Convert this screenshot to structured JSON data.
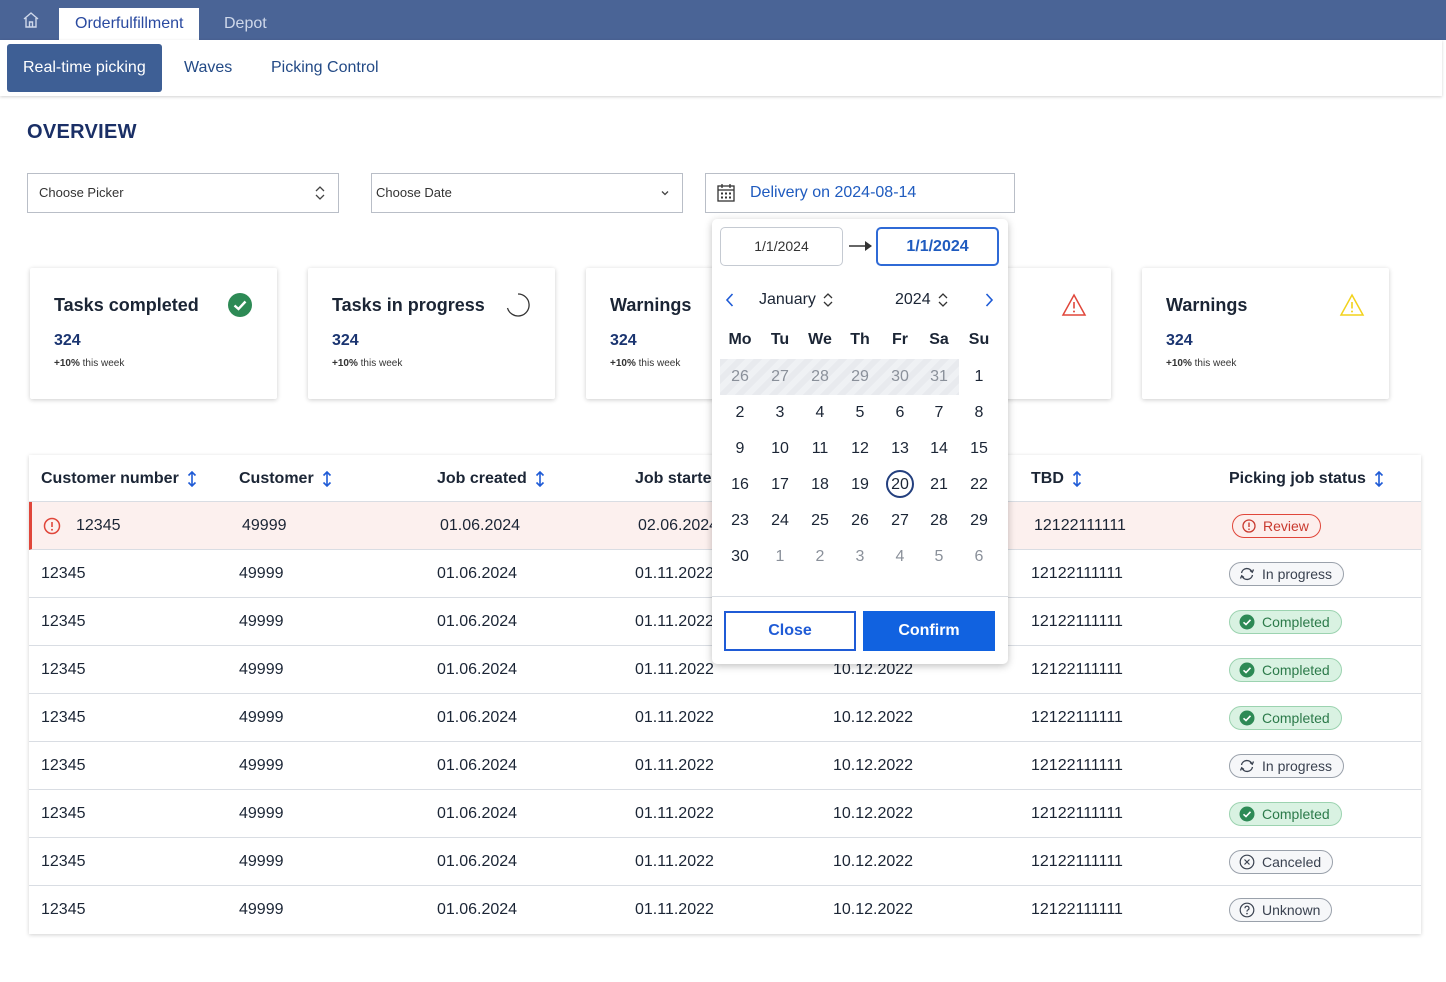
{
  "top_tabs": {
    "orderfulfillment": "Orderfulfillment",
    "depot": "Depot"
  },
  "sub_tabs": {
    "realtime": "Real-time picking",
    "waves": "Waves",
    "picking_control": "Picking Control"
  },
  "page_title": "OVERVIEW",
  "filters": {
    "picker": "Choose Picker",
    "date": "Choose Date",
    "delivery": "Delivery on 2024-08-14"
  },
  "cards": [
    {
      "title": "Tasks completed",
      "value": "324",
      "trend": "+10%",
      "trend_suffix": " this week",
      "icon": "check-circle-icon"
    },
    {
      "title": "Tasks in progress",
      "value": "324",
      "trend": "+10%",
      "trend_suffix": " this week",
      "icon": "spinner-icon"
    },
    {
      "title": "Warnings",
      "value": "324",
      "trend": "+10%",
      "trend_suffix": " this week",
      "icon": "warning-icon"
    },
    {
      "title": "",
      "value": "",
      "trend": "",
      "trend_suffix": "",
      "icon": "alert-triangle-red-icon"
    },
    {
      "title": "Warnings",
      "value": "324",
      "trend": "+10%",
      "trend_suffix": " this week",
      "icon": "warning-yellow-icon"
    }
  ],
  "table": {
    "headers": {
      "customer_number": "Customer number",
      "customer": "Customer",
      "job_created": "Job created",
      "job_started": "Job started",
      "tbd": "TBD",
      "status": "Picking job status"
    },
    "rows": [
      {
        "customer_number": "12345",
        "customer": "49999",
        "job_created": "01.06.2024",
        "job_started": "02.06.2024",
        "col5": "",
        "tbd": "12122111111",
        "status": "Review"
      },
      {
        "customer_number": "12345",
        "customer": "49999",
        "job_created": "01.06.2024",
        "job_started": "01.11.2022",
        "col5": "",
        "tbd": "12122111111",
        "status": "In progress"
      },
      {
        "customer_number": "12345",
        "customer": "49999",
        "job_created": "01.06.2024",
        "job_started": "01.11.2022",
        "col5": "",
        "tbd": "12122111111",
        "status": "Completed"
      },
      {
        "customer_number": "12345",
        "customer": "49999",
        "job_created": "01.06.2024",
        "job_started": "01.11.2022",
        "col5": "10.12.2022",
        "tbd": "12122111111",
        "status": "Completed"
      },
      {
        "customer_number": "12345",
        "customer": "49999",
        "job_created": "01.06.2024",
        "job_started": "01.11.2022",
        "col5": "10.12.2022",
        "tbd": "12122111111",
        "status": "Completed"
      },
      {
        "customer_number": "12345",
        "customer": "49999",
        "job_created": "01.06.2024",
        "job_started": "01.11.2022",
        "col5": "10.12.2022",
        "tbd": "12122111111",
        "status": "In progress"
      },
      {
        "customer_number": "12345",
        "customer": "49999",
        "job_created": "01.06.2024",
        "job_started": "01.11.2022",
        "col5": "10.12.2022",
        "tbd": "12122111111",
        "status": "Completed"
      },
      {
        "customer_number": "12345",
        "customer": "49999",
        "job_created": "01.06.2024",
        "job_started": "01.11.2022",
        "col5": "10.12.2022",
        "tbd": "12122111111",
        "status": "Canceled"
      },
      {
        "customer_number": "12345",
        "customer": "49999",
        "job_created": "01.06.2024",
        "job_started": "01.11.2022",
        "col5": "10.12.2022",
        "tbd": "12122111111",
        "status": "Unknown"
      }
    ]
  },
  "calendar": {
    "range_start": "1/1/2024",
    "range_end": "1/1/2024",
    "month": "January",
    "year": "2024",
    "weekdays": [
      "Mo",
      "Tu",
      "We",
      "Th",
      "Fr",
      "Sa",
      "Su"
    ],
    "weeks": [
      [
        "26",
        "27",
        "28",
        "29",
        "30",
        "31",
        "1"
      ],
      [
        "2",
        "3",
        "4",
        "5",
        "6",
        "7",
        "8"
      ],
      [
        "9",
        "10",
        "11",
        "12",
        "13",
        "14",
        "15"
      ],
      [
        "16",
        "17",
        "18",
        "19",
        "20",
        "21",
        "22"
      ],
      [
        "23",
        "24",
        "25",
        "26",
        "27",
        "28",
        "29"
      ],
      [
        "30",
        "1",
        "2",
        "3",
        "4",
        "5",
        "6"
      ]
    ],
    "today": "20",
    "close_label": "Close",
    "confirm_label": "Confirm"
  },
  "colors": {
    "topbar": "#4a6496",
    "accent": "#1162e0",
    "review": "#e0463a",
    "completed": "#2c7a4a"
  }
}
